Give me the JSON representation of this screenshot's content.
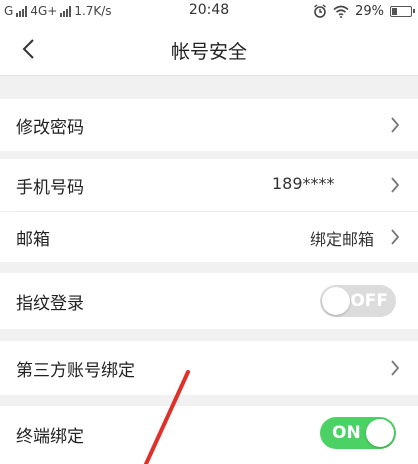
{
  "status_bar": {
    "carrier1": "G",
    "carrier2": "4G+",
    "speed": "1.7K/s",
    "time": "20:48",
    "battery": "29%",
    "icons": [
      "alarm-icon",
      "wifi-icon",
      "battery-icon"
    ]
  },
  "header": {
    "title": "帐号安全",
    "back_icon": "back-icon"
  },
  "settings": {
    "change_password": {
      "label": "修改密码"
    },
    "phone": {
      "label": "手机号码",
      "value": "189****"
    },
    "email": {
      "label": "邮箱",
      "value": "绑定邮箱"
    },
    "fingerprint": {
      "label": "指纹登录",
      "toggle_text": "OFF",
      "state": "off"
    },
    "third_party": {
      "label": "第三方账号绑定"
    },
    "device_binding": {
      "label": "终端绑定",
      "toggle_text": "ON",
      "state": "on"
    }
  },
  "colors": {
    "background": "#f1f1f1",
    "toggle_on": "#4cd264",
    "toggle_off": "#dcdcdc",
    "annotation_arrow": "#e0302a"
  }
}
